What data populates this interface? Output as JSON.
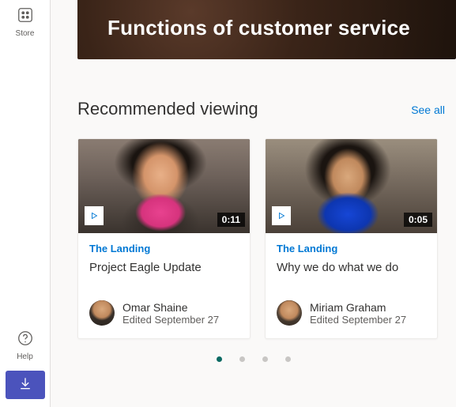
{
  "rail": {
    "store": "Store",
    "help": "Help"
  },
  "hero": {
    "title": "Functions of customer service"
  },
  "recommended": {
    "heading": "Recommended viewing",
    "see_all": "See all",
    "cards": [
      {
        "duration": "0:11",
        "site": "The Landing",
        "title": "Project Eagle Update",
        "author": "Omar Shaine",
        "edited": "Edited September 27"
      },
      {
        "duration": "0:05",
        "site": "The Landing",
        "title": "Why we do what we do",
        "author": "Miriam Graham",
        "edited": "Edited September 27"
      }
    ]
  }
}
